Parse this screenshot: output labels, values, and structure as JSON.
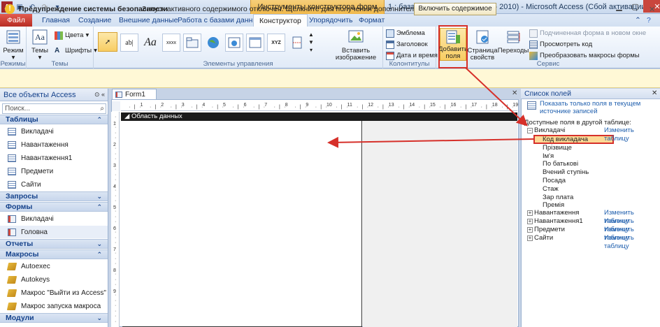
{
  "title_bar": {
    "context_title": "Инструменты конструктора форм",
    "app_title": "1 : база данных (Access 2007 - 2010)  -  Microsoft Access (Сбой активации продукта)"
  },
  "tabs": [
    "Файл",
    "Главная",
    "Создание",
    "Внешние данные",
    "Работа с базами данных",
    "Конструктор",
    "Упорядочить",
    "Формат"
  ],
  "ribbon": {
    "view_group": {
      "label": "Режимы",
      "button": "Режим"
    },
    "themes_group": {
      "label": "Темы",
      "themes_button": "Темы",
      "colors": "Цвета",
      "fonts": "Шрифты"
    },
    "controls_group": {
      "label": "Элементы управления",
      "insert_image": "Вставить изображение"
    },
    "header_group": {
      "label": "Колонтитулы",
      "emblem": "Эмблема",
      "title": "Заголовок",
      "datetime": "Дата и время"
    },
    "tools_group": {
      "label": "Сервис",
      "add_fields": "Добавить поля",
      "property_sheet": "Страница свойств",
      "tab_order": "Переходы",
      "subform": "Подчиненная форма в новом окне",
      "view_code": "Просмотреть код",
      "convert_macros": "Преобразовать макросы формы"
    }
  },
  "warning": {
    "title": "Предупреждение системы безопасности",
    "message": "Запуск активного содержимого отключен. Щелкните для получения дополнительных сведений.",
    "button": "Включить содержимое"
  },
  "nav": {
    "header": "Все объекты Access",
    "search_placeholder": "Поиск...",
    "sections": [
      {
        "label": "Таблицы",
        "items": [
          "Викладачі",
          "Навантаження",
          "Навантаження1",
          "Предмети",
          "Сайти"
        ]
      },
      {
        "label": "Запросы",
        "items": []
      },
      {
        "label": "Формы",
        "items": [
          "Викладачі",
          "Головна"
        ]
      },
      {
        "label": "Отчеты",
        "items": []
      },
      {
        "label": "Макросы",
        "items": [
          "Autoexec",
          "Autokeys",
          "Макрос \"Выйти из Access\"",
          "Макрос запуска макроса"
        ]
      },
      {
        "label": "Модули",
        "items": []
      }
    ]
  },
  "document": {
    "tab": "Form1",
    "section_label": "Область данных",
    "ruler_numbers": [
      "1",
      "2",
      "3",
      "4",
      "5",
      "6",
      "7",
      "8",
      "9",
      "10",
      "11",
      "12",
      "13",
      "14",
      "15",
      "16",
      "17",
      "18",
      "19"
    ]
  },
  "field_list": {
    "header": "Список полей",
    "show_only": "Показать только поля в текущем источнике записей",
    "available": "Доступные поля в другой таблице:",
    "edit_table": "Изменить таблицу",
    "expanded_table": "Викладачі",
    "fields": [
      "Код викладача",
      "Прізвище",
      "Ім'я",
      "По батькові",
      "Вчений ступінь",
      "Посада",
      "Стаж",
      "Зар плата",
      "Премія"
    ],
    "other_tables": [
      "Навантаження",
      "Навантаження1",
      "Предмети",
      "Сайти"
    ]
  }
}
